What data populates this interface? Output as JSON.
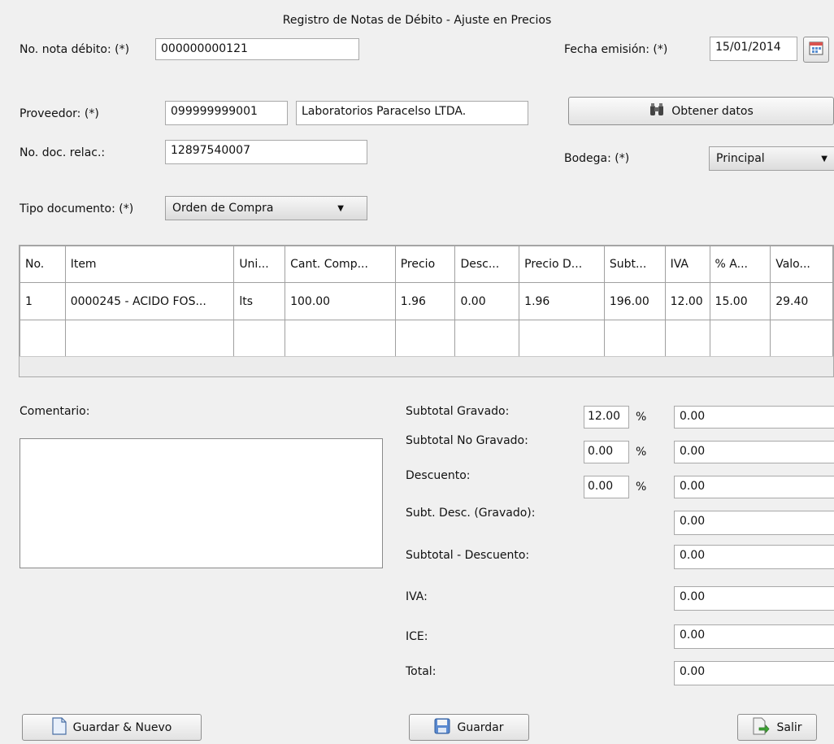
{
  "window": {
    "title": "Registro de Notas de Débito - Ajuste en Precios"
  },
  "form": {
    "nota_label": "No. nota débito: (*)",
    "nota_value": "000000000121",
    "fecha_label": "Fecha emisión: (*)",
    "fecha_value": "15/01/2014",
    "proveedor_label": "Proveedor: (*)",
    "proveedor_ruc": "099999999001",
    "proveedor_nombre": "Laboratorios Paracelso LTDA.",
    "obtener_label": "Obtener datos",
    "doc_label": "No. doc. relac.:",
    "doc_value": "12897540007",
    "bodega_label": "Bodega: (*)",
    "bodega_value": "Principal",
    "tipo_label": "Tipo documento: (*)",
    "tipo_value": "Orden de Compra"
  },
  "table": {
    "headers": [
      "No.",
      "Item",
      "Uni...",
      "Cant. Comp...",
      "Precio",
      "Desc...",
      "Precio D...",
      "Subt...",
      "IVA",
      "% A...",
      "Valo..."
    ],
    "rows": [
      [
        "1",
        "0000245 - ACIDO FOS...",
        "lts",
        "100.00",
        "1.96",
        "0.00",
        "1.96",
        "196.00",
        "12.00",
        "15.00",
        "29.40"
      ]
    ]
  },
  "comentario": {
    "label": "Comentario:",
    "value": ""
  },
  "totals": {
    "subtotal_gravado_label": "Subtotal Gravado:",
    "subtotal_gravado_pct": "12.00",
    "subtotal_gravado_value": "0.00",
    "subtotal_no_gravado_label": "Subtotal No Gravado:",
    "subtotal_no_gravado_pct": "0.00",
    "subtotal_no_gravado_value": "0.00",
    "descuento_label": "Descuento:",
    "descuento_pct": "0.00",
    "descuento_value": "0.00",
    "subt_desc_label": "Subt. Desc. (Gravado):",
    "subt_desc_value": "0.00",
    "subtotal_menos_label": "Subtotal - Descuento:",
    "subtotal_menos_value": "0.00",
    "iva_label": "IVA:",
    "iva_value": "0.00",
    "ice_label": "ICE:",
    "ice_value": "0.00",
    "total_label": "Total:",
    "total_value": "0.00",
    "pct_symbol": "%"
  },
  "buttons": {
    "guardar_nuevo": "Guardar & Nuevo",
    "guardar": "Guardar",
    "salir": "Salir"
  },
  "icons": {
    "calendar": "calendar-icon",
    "binoculars": "binoculars-icon",
    "document": "document-icon",
    "save": "floppy-disk-icon",
    "exit": "exit-icon"
  }
}
